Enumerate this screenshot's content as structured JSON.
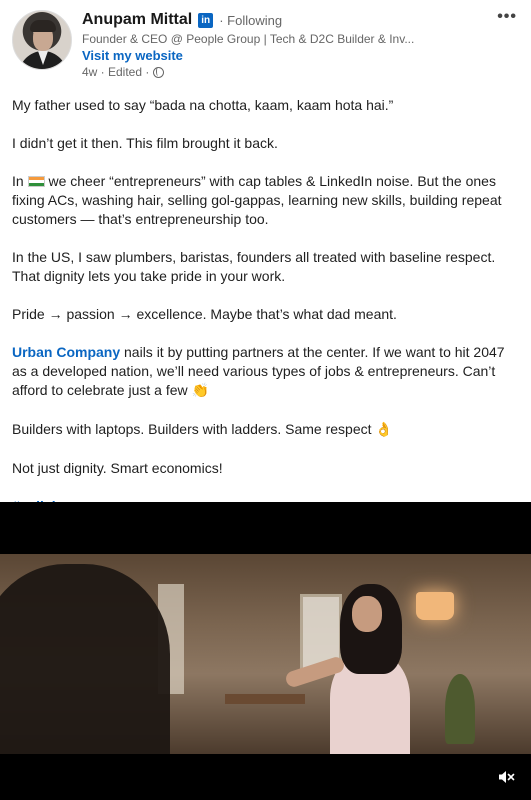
{
  "post": {
    "author_name": "Anupam Mittal",
    "linkedin_badge": "in",
    "follow_status": "· Following",
    "headline": "Founder & CEO @ People Group | Tech & D2C Builder & Inv...",
    "website_label": "Visit my website",
    "meta": "4w · Edited ·",
    "more_label": "•••"
  },
  "content": {
    "p1": "My father used to say “bada na chotta, kaam, kaam hota hai.”",
    "p2": "I didn’t get it then. This film brought it back.",
    "p3_before": "In",
    "p3_after": " we cheer “entrepreneurs” with cap tables & LinkedIn noise. But the ones fixing ACs, washing hair, selling gol-gappas, learning new skills, building repeat customers — that’s entrepreneurship too.",
    "p4": "In the US, I saw plumbers, baristas, founders all treated with baseline respect. That dignity lets you take pride in your work.",
    "p5": "Pride → passion → excellence. Maybe that’s what dad meant.",
    "p6_link": "Urban Company",
    "p6_text": " nails it by putting partners at the center. If we want to hit 2047 as a developed nation, we’ll need various types of jobs & entrepreneurs. Can’t afford to celebrate just a few ",
    "p6_emoji": "👏",
    "p7_text": "Builders with laptops. Builders with ladders. Same respect ",
    "p7_emoji": "👌",
    "p8": "Not just dignity. Smart economics!",
    "hashtag": "#collab"
  },
  "video": {
    "mute_icon": "volume-muted-icon"
  },
  "colors": {
    "link": "#0a66c2",
    "text": "#1f1f1f",
    "muted": "#666666"
  }
}
